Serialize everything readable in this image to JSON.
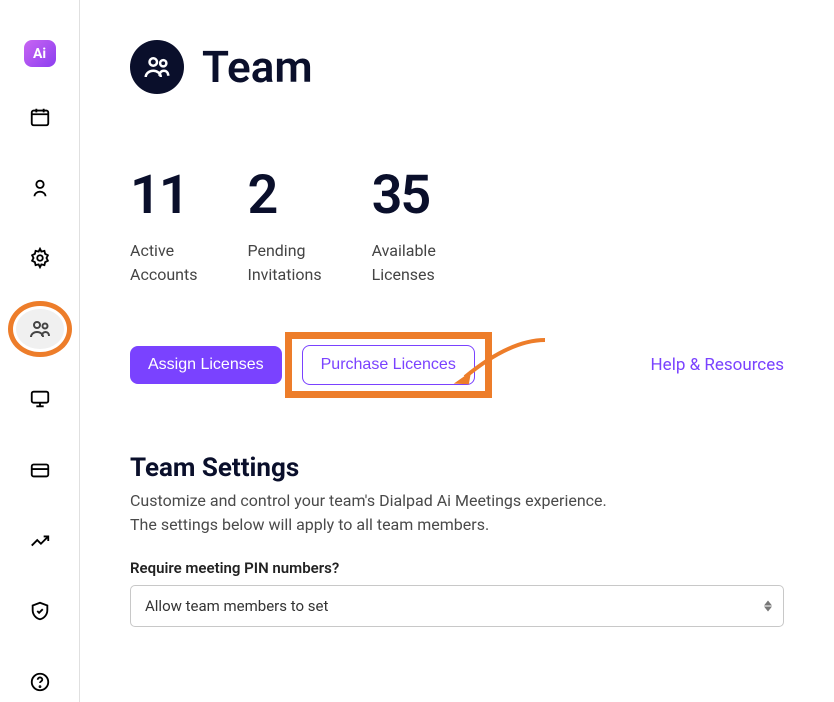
{
  "logo": "Ai",
  "header": {
    "title": "Team"
  },
  "stats": [
    {
      "value": "11",
      "label1": "Active",
      "label2": "Accounts"
    },
    {
      "value": "2",
      "label1": "Pending",
      "label2": "Invitations"
    },
    {
      "value": "35",
      "label1": "Available",
      "label2": "Licenses"
    }
  ],
  "actions": {
    "assign": "Assign Licenses",
    "purchase": "Purchase Licences",
    "help": "Help & Resources"
  },
  "settings": {
    "title": "Team Settings",
    "desc1": "Customize and control your team's Dialpad Ai Meetings experience.",
    "desc2": "The settings below will apply to all team members.",
    "pin_label": "Require meeting PIN numbers?",
    "pin_value": "Allow team members to set"
  }
}
